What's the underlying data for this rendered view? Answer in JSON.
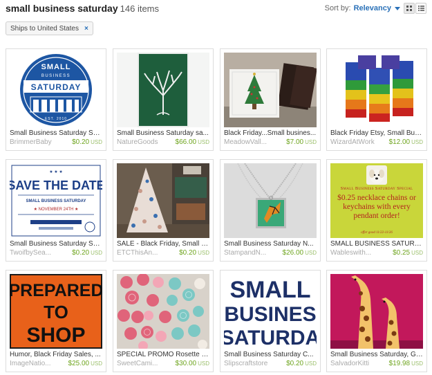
{
  "search": {
    "query": "small business saturday",
    "count": "146 items"
  },
  "sort": {
    "label": "Sort by:",
    "value": "Relevancy"
  },
  "filter": {
    "chip_label": "Ships to United States",
    "remove_glyph": "×"
  },
  "currency": "USD",
  "items": [
    {
      "title": "Small Business Saturday Sp...",
      "shop": "BrimmerBaby",
      "price": "$0.20",
      "image": "small-business-saturday-logo",
      "art": {
        "circle_top": "SMALL",
        "circle_mid": "BUSINESS",
        "circle_main": "SATURDAY",
        "circle_est": "EST. 2010"
      }
    },
    {
      "title": "Small Business Saturday sa...",
      "shop": "NatureGoods",
      "price": "$66.00",
      "image": "tree-wall-hanging"
    },
    {
      "title": "Black Friday...Small busines...",
      "shop": "MeadowVall...",
      "price": "$7.00",
      "image": "christmas-tree-pillows"
    },
    {
      "title": "Black Friday Etsy, Small Bus...",
      "shop": "WizardAtWork",
      "price": "$12.00",
      "image": "rainbow-soap-cubes"
    },
    {
      "title": "Small Business Saturday Sa...",
      "shop": "TwoifbySea...",
      "price": "$0.20",
      "image": "save-the-date-card",
      "art": {
        "line1": "SAVE THE DATE",
        "line2": "SMALL BUSINESS SATURDAY",
        "line3": "★ NOVEMBER 24TH ★"
      }
    },
    {
      "title": "SALE - Black Friday, Small B...",
      "shop": "ETCThisAn...",
      "price": "$0.20",
      "image": "shop-christmas-tree"
    },
    {
      "title": "Small Business Saturday N...",
      "shop": "StampandN...",
      "price": "$26.00",
      "image": "butterfly-pendant-necklace"
    },
    {
      "title": "SMALL BUSINESS SATURD...",
      "shop": "Wableswith...",
      "price": "$0.25",
      "image": "special-offer-sign",
      "art": {
        "heading": "Small Business Saturday Special",
        "body": "$0.25 necklace chains or keychains with every pendant order!",
        "footer": "offer good 11/22-11/26"
      }
    },
    {
      "title": "Humor, Black Friday Sales, ...",
      "shop": "ImageNatio...",
      "price": "$25.00",
      "image": "prepared-to-shop-sign",
      "art": {
        "line1": "PREPARED",
        "line2": "TO",
        "line3": "SHOP"
      }
    },
    {
      "title": "SPECIAL PROMO Rosette N...",
      "shop": "SweetCami...",
      "price": "$30.00",
      "image": "fabric-rosettes"
    },
    {
      "title": "Small Business Saturday C...",
      "shop": "Slipscraftstore",
      "price": "$0.20",
      "image": "small-business-saturday-banner",
      "art": {
        "line1": "SMALL",
        "line2": "BUSINES",
        "line3": "SATURDA"
      }
    },
    {
      "title": "Small Business Saturday, Gi...",
      "shop": "SalvadorKitti",
      "price": "$19.98",
      "image": "giraffe-art-print"
    }
  ],
  "colors": {
    "accent": "#2a71b8",
    "price": "#6fa51f",
    "navy": "#1d3f87"
  }
}
